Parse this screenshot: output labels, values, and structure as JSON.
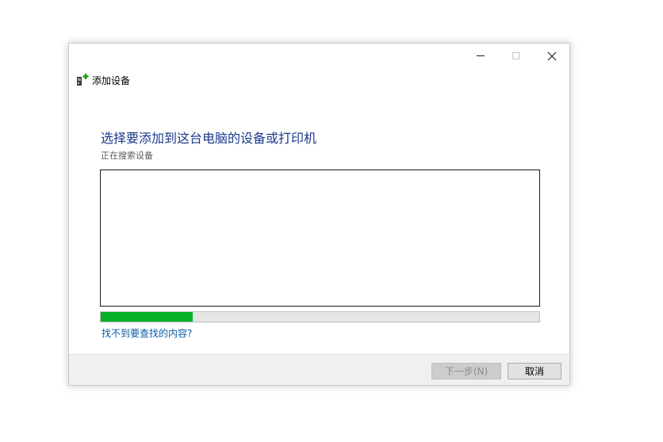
{
  "window": {
    "title": "添加设备",
    "controls": {
      "minimize": "minimize-icon",
      "maximize": "maximize-icon",
      "close": "close-icon"
    }
  },
  "main": {
    "heading": "选择要添加到这台电脑的设备或打印机",
    "status": "正在搜索设备",
    "progress_fraction": 0.21,
    "help_link": "找不到要查找的内容?"
  },
  "footer": {
    "next_label": "下一步(N)",
    "next_enabled": false,
    "cancel_label": "取消"
  },
  "colors": {
    "heading": "#1a3a8a",
    "link": "#0a5aa6",
    "progress": "#06b025"
  }
}
